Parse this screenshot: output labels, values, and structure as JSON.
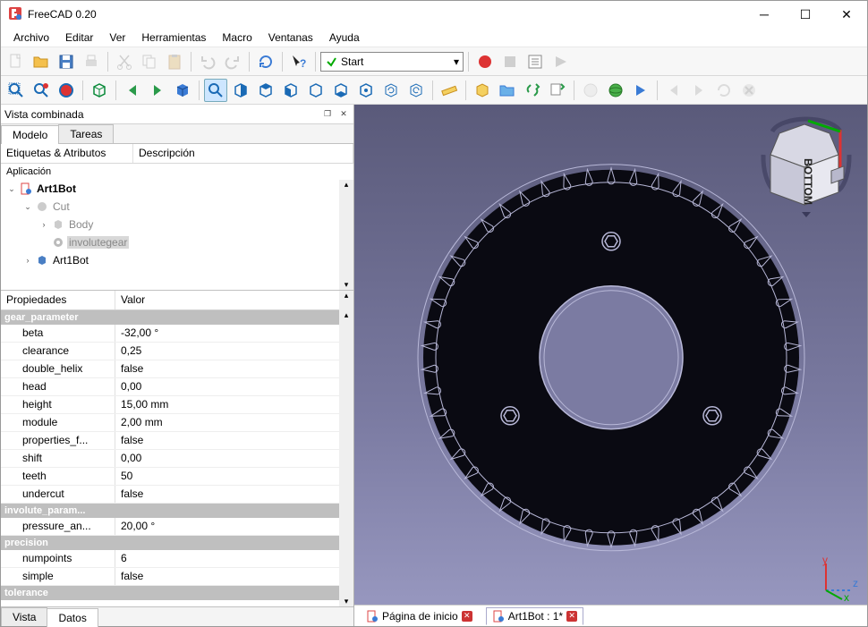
{
  "window": {
    "title": "FreeCAD 0.20"
  },
  "menu": [
    "Archivo",
    "Editar",
    "Ver",
    "Herramientas",
    "Macro",
    "Ventanas",
    "Ayuda"
  ],
  "toolbar": {
    "start_label": "Start"
  },
  "panel": {
    "title": "Vista combinada",
    "tabs": [
      "Modelo",
      "Tareas"
    ],
    "tree_headers": [
      "Etiquetas & Atributos",
      "Descripción"
    ],
    "application_label": "Aplicación",
    "tree": [
      {
        "indent": 0,
        "expand": "v",
        "icon": "doc",
        "label": "Art1Bot",
        "bold": true
      },
      {
        "indent": 1,
        "expand": "v",
        "icon": "cut",
        "label": "Cut",
        "grey": true
      },
      {
        "indent": 2,
        "expand": ">",
        "icon": "body",
        "label": "Body",
        "grey": true
      },
      {
        "indent": 2,
        "expand": "",
        "icon": "gear",
        "label": "involutegear",
        "grey": true,
        "selected": true
      },
      {
        "indent": 1,
        "expand": ">",
        "icon": "part",
        "label": "Art1Bot"
      }
    ],
    "prop_headers": [
      "Propiedades",
      "Valor"
    ],
    "props": [
      {
        "group": "gear_parameter"
      },
      {
        "name": "beta",
        "value": "-32,00 °"
      },
      {
        "name": "clearance",
        "value": "0,25"
      },
      {
        "name": "double_helix",
        "value": "false"
      },
      {
        "name": "head",
        "value": "0,00"
      },
      {
        "name": "height",
        "value": "15,00 mm"
      },
      {
        "name": "module",
        "value": "2,00 mm"
      },
      {
        "name": "properties_f...",
        "value": "false"
      },
      {
        "name": "shift",
        "value": "0,00"
      },
      {
        "name": "teeth",
        "value": "50"
      },
      {
        "name": "undercut",
        "value": "false"
      },
      {
        "group": "involute_param..."
      },
      {
        "name": "pressure_an...",
        "value": "20,00 °"
      },
      {
        "group": "precision"
      },
      {
        "name": "numpoints",
        "value": "6"
      },
      {
        "name": "simple",
        "value": "false"
      },
      {
        "group": "tolerance"
      }
    ],
    "bottom_tabs": [
      "Vista",
      "Datos"
    ]
  },
  "navcube": {
    "face": "BOTTOM"
  },
  "doc_tabs": [
    {
      "label": "Página de inicio",
      "active": false
    },
    {
      "label": "Art1Bot : 1*",
      "active": true
    }
  ],
  "axes": [
    "y",
    "z",
    "x"
  ]
}
